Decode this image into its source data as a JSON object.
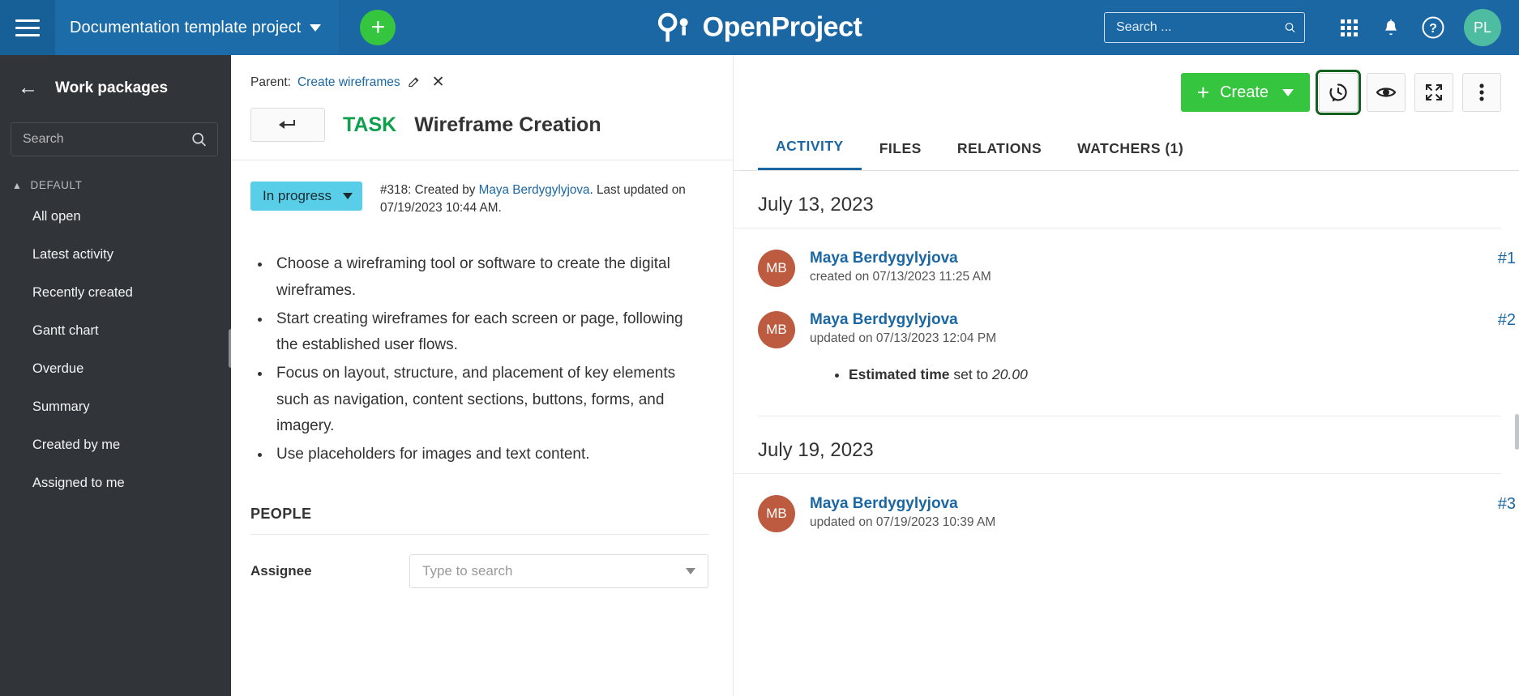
{
  "header": {
    "menu_icon": "hamburger-icon",
    "project_name": "Documentation template project",
    "add_label": "+",
    "logo_text": "OpenProject",
    "search_placeholder": "Search ...",
    "search_value": "",
    "search_icon": "search-icon",
    "modules_icon": "grid-icon",
    "notifications_icon": "bell-icon",
    "help_icon": "help-circle-icon",
    "avatar_initials": "PL",
    "avatar_color": "#4DBCA0",
    "bar_color": "#1A67A3"
  },
  "sidebar": {
    "back_icon": "arrow-left-icon",
    "title": "Work packages",
    "search_placeholder": "Search",
    "search_value": "",
    "section_label": "DEFAULT",
    "section_chevron": "chevron-up-icon",
    "items": [
      {
        "label": "All open"
      },
      {
        "label": "Latest activity"
      },
      {
        "label": "Recently created"
      },
      {
        "label": "Gantt chart"
      },
      {
        "label": "Overdue"
      },
      {
        "label": "Summary"
      },
      {
        "label": "Created by me"
      },
      {
        "label": "Assigned to me"
      }
    ]
  },
  "work_package": {
    "parent_prefix": "Parent:",
    "parent_name": "Create wireframes",
    "parent_edit_icon": "pencil-icon",
    "parent_remove_icon": "close-icon",
    "back_icon": "arrow-back-icon",
    "type": "TASK",
    "type_color": "#0FA04E",
    "title": "Wireframe Creation",
    "status": "In progress",
    "status_color": "#58CEE8",
    "meta_prefix": "#318: Created by ",
    "meta_author": "Maya Berdygylyjova",
    "meta_suffix": ". Last updated on 07/19/2023 10:44 AM.",
    "description": [
      "Choose a wireframing tool or software to create the digital wireframes.",
      "Start creating wireframes for each screen or page, following the established user flows.",
      "Focus on layout, structure, and placement of key elements such as navigation, content sections, buttons, forms, and imagery.",
      "Use placeholders for images and text content."
    ],
    "people_section": "PEOPLE",
    "assignee_label": "Assignee",
    "assignee_placeholder": "Type to search"
  },
  "toolbar": {
    "create_label": "Create",
    "create_plus": "+",
    "create_color": "#35C53F",
    "activity_icon": "activity-history-icon",
    "watch_icon": "eye-watch-icon",
    "fullscreen_icon": "fullscreen-expand-icon",
    "more_icon": "more-vertical-icon",
    "focus_outline_color": "#14601E"
  },
  "tabs": [
    {
      "label": "ACTIVITY",
      "active": true
    },
    {
      "label": "FILES",
      "active": false
    },
    {
      "label": "RELATIONS",
      "active": false
    },
    {
      "label": "WATCHERS (1)",
      "active": false
    }
  ],
  "activity": {
    "days": [
      {
        "date": "July 13, 2023",
        "entries": [
          {
            "initials": "MB",
            "user": "Maya Berdygylyjova",
            "time": "created on 07/13/2023 11:25 AM",
            "anchor": "#1",
            "details": []
          },
          {
            "initials": "MB",
            "user": "Maya Berdygylyjova",
            "time": "updated on 07/13/2023 12:04 PM",
            "anchor": "#2",
            "details": [
              {
                "label": "Estimated time",
                "middle": " set to ",
                "value": "20.00"
              }
            ]
          }
        ]
      },
      {
        "date": "July 19, 2023",
        "entries": [
          {
            "initials": "MB",
            "user": "Maya Berdygylyjova",
            "time": "updated on 07/19/2023 10:39 AM",
            "anchor": "#3",
            "details": []
          }
        ]
      }
    ]
  }
}
